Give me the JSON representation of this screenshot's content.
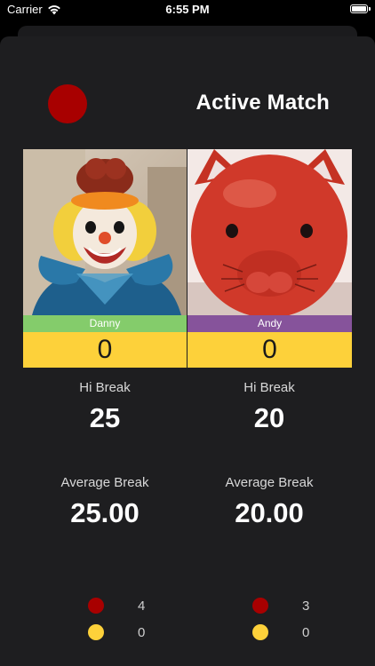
{
  "status_bar": {
    "carrier": "Carrier",
    "time": "6:55 PM"
  },
  "header": {
    "title": "Active Match",
    "record_button_icon": "red-circle",
    "colors": {
      "red": "#a80000",
      "yellow": "#fdd13a"
    }
  },
  "players": [
    {
      "name": "Danny",
      "name_color": "#84cc6b",
      "photo": "clown-figurine",
      "score": "0",
      "hi_break_label": "Hi Break",
      "hi_break": "25",
      "avg_break_label": "Average Break",
      "avg_break": "25.00",
      "red_balls": "4",
      "yellow_balls": "0"
    },
    {
      "name": "Andy",
      "name_color": "#86539b",
      "photo": "red-cat-figurine",
      "score": "0",
      "hi_break_label": "Hi Break",
      "hi_break": "20",
      "avg_break_label": "Average Break",
      "avg_break": "20.00",
      "red_balls": "3",
      "yellow_balls": "0"
    }
  ]
}
